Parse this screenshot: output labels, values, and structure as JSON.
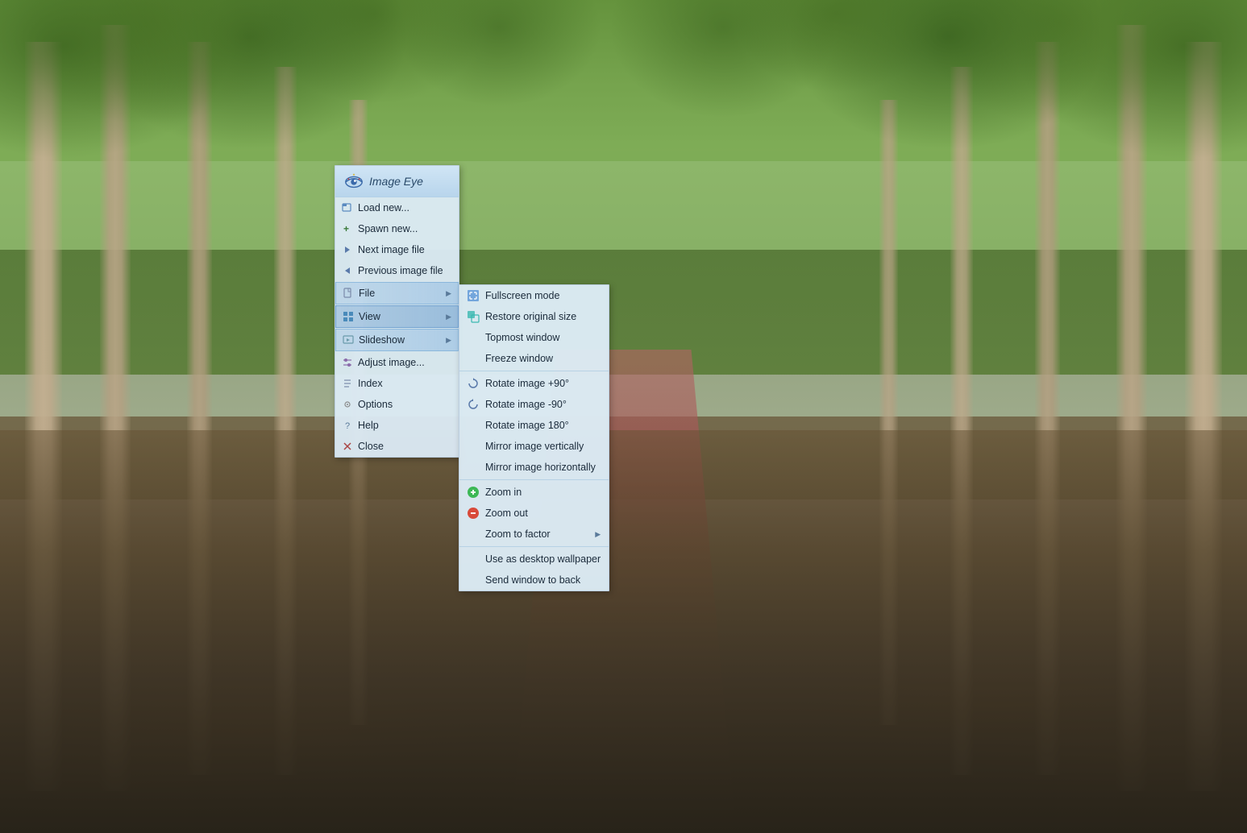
{
  "app": {
    "title": "Image Eye",
    "icon_label": "eye-icon"
  },
  "main_menu": {
    "items": [
      {
        "id": "load-new",
        "label": "Load new...",
        "icon": "folder-icon",
        "has_submenu": false
      },
      {
        "id": "spawn-new",
        "label": "Spawn new...",
        "icon": "plus-icon",
        "has_submenu": false
      },
      {
        "id": "next-image",
        "label": "Next image file",
        "icon": "arrow-right-icon",
        "has_submenu": false
      },
      {
        "id": "prev-image",
        "label": "Previous image file",
        "icon": "arrow-left-icon",
        "has_submenu": false
      },
      {
        "id": "file",
        "label": "File",
        "icon": "file-icon",
        "has_submenu": true
      },
      {
        "id": "view",
        "label": "View",
        "icon": "view-icon",
        "has_submenu": true,
        "active": true
      },
      {
        "id": "slideshow",
        "label": "Slideshow",
        "icon": "slideshow-icon",
        "has_submenu": true
      },
      {
        "id": "adjust-image",
        "label": "Adjust image...",
        "icon": "adjust-icon",
        "has_submenu": false
      },
      {
        "id": "index",
        "label": "Index",
        "icon": "index-icon",
        "has_submenu": false
      },
      {
        "id": "options",
        "label": "Options",
        "icon": "options-icon",
        "has_submenu": false
      },
      {
        "id": "help",
        "label": "Help",
        "icon": "help-icon",
        "has_submenu": false
      },
      {
        "id": "close",
        "label": "Close",
        "icon": "close-icon",
        "has_submenu": false
      }
    ]
  },
  "view_submenu": {
    "items": [
      {
        "id": "fullscreen",
        "label": "Fullscreen mode",
        "icon": "fullscreen-icon"
      },
      {
        "id": "restore-size",
        "label": "Restore original size",
        "icon": "restore-icon"
      },
      {
        "id": "topmost",
        "label": "Topmost window",
        "icon": null
      },
      {
        "id": "freeze",
        "label": "Freeze window",
        "icon": null
      },
      {
        "separator": true
      },
      {
        "id": "rotate-cw",
        "label": "Rotate image +90°",
        "icon": "rotate-cw-icon"
      },
      {
        "id": "rotate-ccw",
        "label": "Rotate image -90°",
        "icon": "rotate-ccw-icon"
      },
      {
        "id": "rotate-180",
        "label": "Rotate image 180°",
        "icon": null
      },
      {
        "id": "mirror-v",
        "label": "Mirror image vertically",
        "icon": null
      },
      {
        "id": "mirror-h",
        "label": "Mirror image horizontally",
        "icon": null
      },
      {
        "separator": true
      },
      {
        "id": "zoom-in",
        "label": "Zoom in",
        "icon": "zoom-in-icon"
      },
      {
        "id": "zoom-out",
        "label": "Zoom out",
        "icon": "zoom-out-icon"
      },
      {
        "id": "zoom-factor",
        "label": "Zoom to factor",
        "icon": null,
        "has_submenu": true
      },
      {
        "separator": true
      },
      {
        "id": "wallpaper",
        "label": "Use as desktop wallpaper",
        "icon": null
      },
      {
        "id": "send-back",
        "label": "Send window to back",
        "icon": null
      }
    ]
  }
}
